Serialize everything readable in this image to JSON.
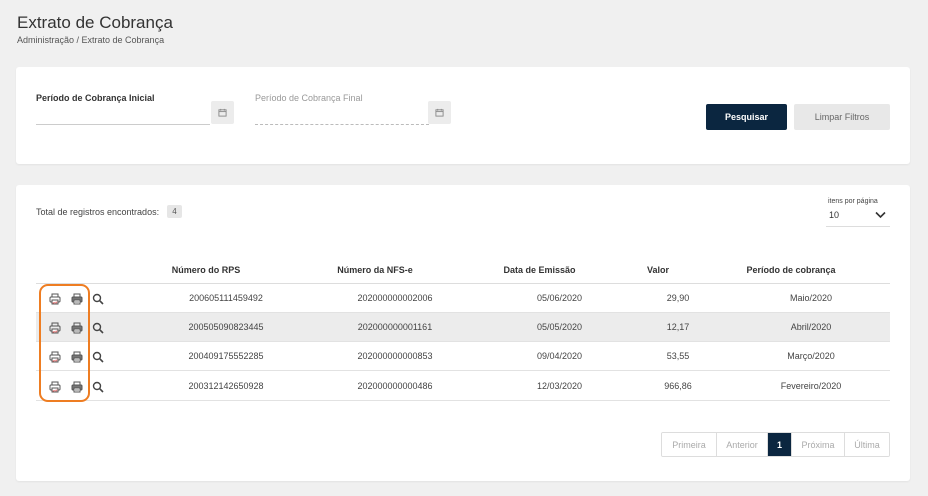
{
  "header": {
    "title": "Extrato de Cobrança",
    "breadcrumb": "Administração / Extrato de Cobrança"
  },
  "filters": {
    "start_label": "Período de Cobrança Inicial",
    "end_label": "Período de Cobrança Final",
    "start_value": "",
    "end_value": "",
    "search_button": "Pesquisar",
    "clear_button": "Limpar Filtros"
  },
  "results": {
    "total_label": "Total de registros encontrados:",
    "total_count": "4",
    "items_per_page_label": "itens por página",
    "items_per_page_value": "10",
    "columns": [
      "Número do RPS",
      "Número da NFS-e",
      "Data de Emissão",
      "Valor",
      "Período de cobrança"
    ],
    "rows": [
      {
        "rps": "200605111459492",
        "nfse": "202000000002006",
        "date": "05/06/2020",
        "value": "29,90",
        "period": "Maio/2020"
      },
      {
        "rps": "200505090823445",
        "nfse": "202000000001161",
        "date": "05/05/2020",
        "value": "12,17",
        "period": "Abril/2020"
      },
      {
        "rps": "200409175552285",
        "nfse": "202000000000853",
        "date": "09/04/2020",
        "value": "53,55",
        "period": "Março/2020"
      },
      {
        "rps": "200312142650928",
        "nfse": "202000000000486",
        "date": "12/03/2020",
        "value": "966,86",
        "period": "Fevereiro/2020"
      }
    ],
    "row_icons": [
      "pdf-print-icon",
      "print-icon",
      "search-icon"
    ]
  },
  "pagination": {
    "first": "Primeira",
    "prev": "Anterior",
    "current": "1",
    "next": "Próxima",
    "last": "Última"
  },
  "colors": {
    "primary": "#0b2640",
    "highlight": "#ee7d22",
    "background": "#f0f0f0"
  }
}
